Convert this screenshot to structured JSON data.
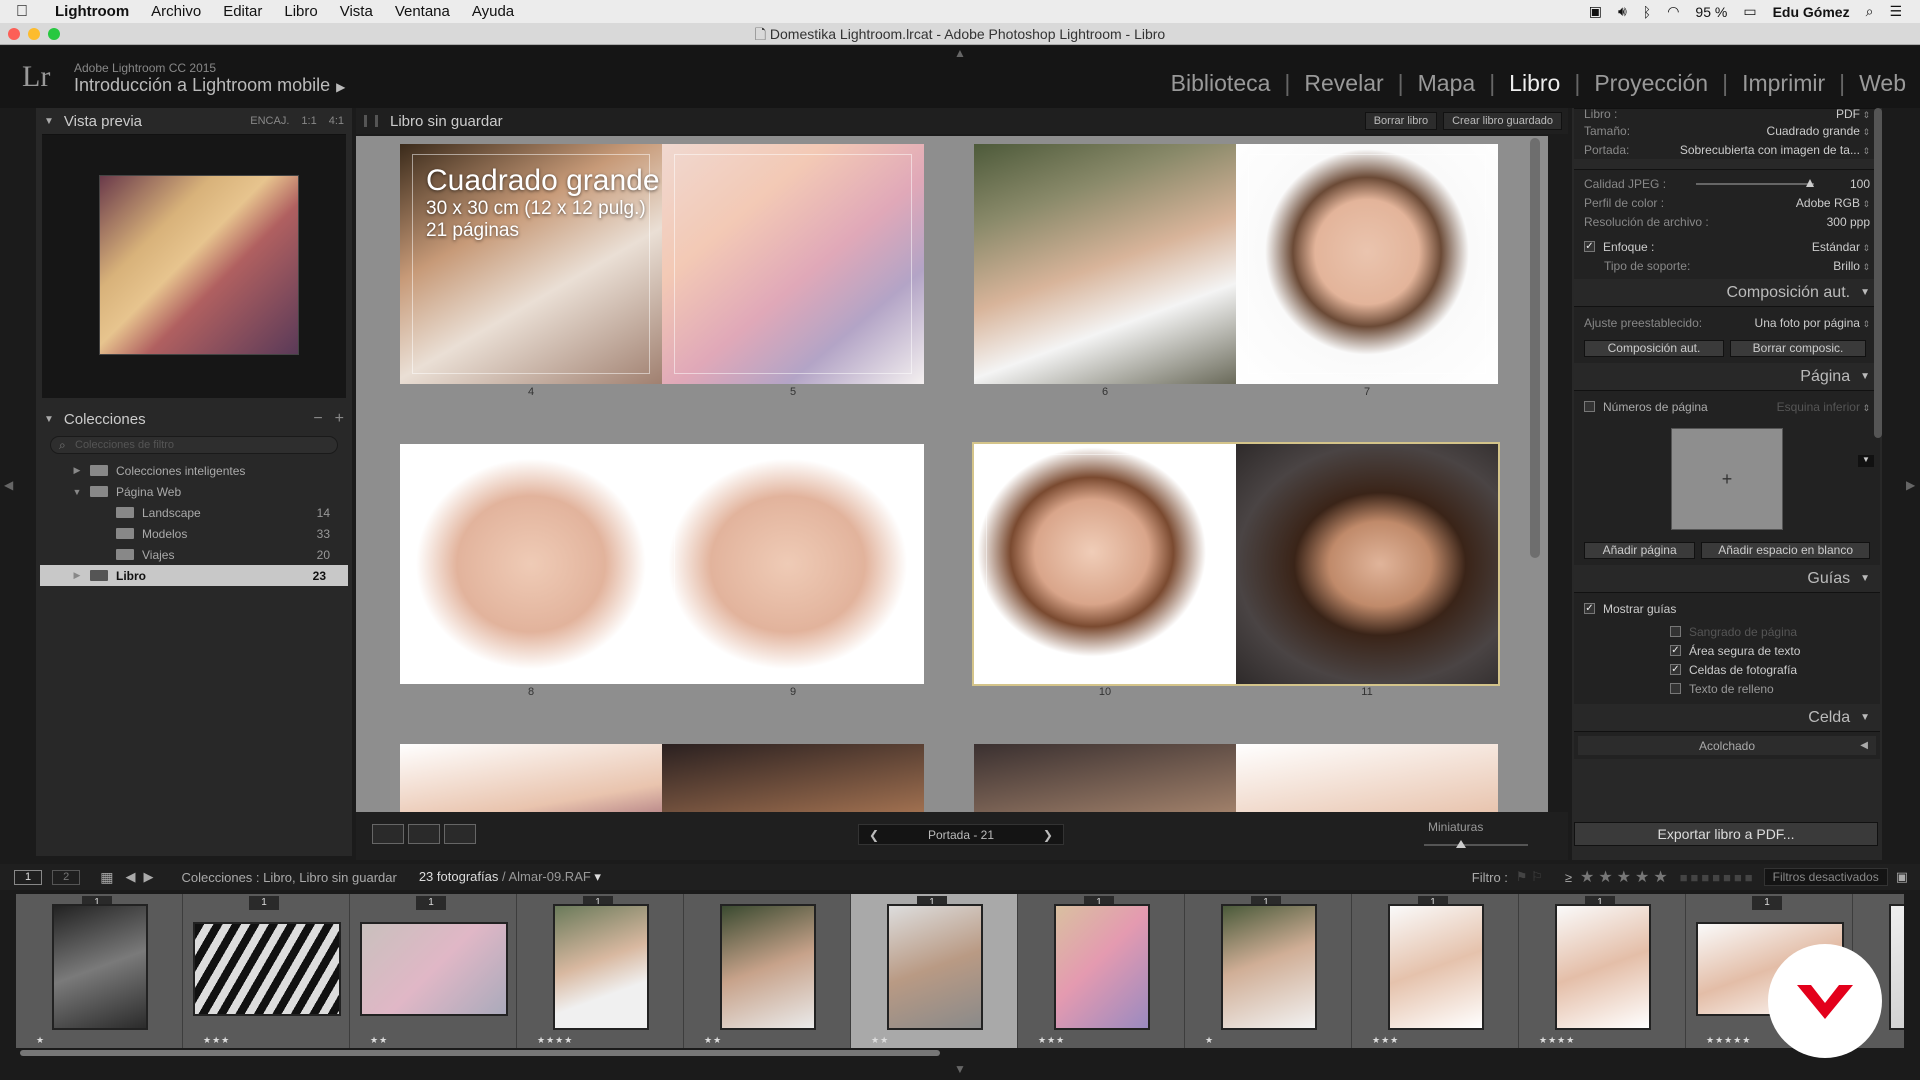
{
  "menubar": {
    "app": "Lightroom",
    "items": [
      "Archivo",
      "Editar",
      "Libro",
      "Vista",
      "Ventana",
      "Ayuda"
    ],
    "battery": "95 %",
    "user": "Edu Gómez"
  },
  "window": {
    "title": "Domestika Lightroom.lrcat - Adobe Photoshop Lightroom - Libro"
  },
  "identity": {
    "logo": "Lr",
    "product": "Adobe Lightroom CC 2015",
    "catalog": "Introducción a Lightroom mobile"
  },
  "modules": [
    "Biblioteca",
    "Revelar",
    "Mapa",
    "Libro",
    "Proyección",
    "Imprimir",
    "Web"
  ],
  "left": {
    "preview": {
      "title": "Vista previa",
      "opts": [
        "ENCAJ.",
        "1:1",
        "4:1"
      ]
    },
    "collections": {
      "title": "Colecciones",
      "search_placeholder": "Colecciones de filtro",
      "items": [
        {
          "label": "Colecciones inteligentes",
          "count": ""
        },
        {
          "label": "Página Web",
          "count": ""
        },
        {
          "label": "Landscape",
          "count": "14"
        },
        {
          "label": "Modelos",
          "count": "33"
        },
        {
          "label": "Viajes",
          "count": "20"
        },
        {
          "label": "Libro",
          "count": "23"
        }
      ]
    }
  },
  "center": {
    "doc_title": "Libro sin guardar",
    "buttons": [
      "Borrar libro",
      "Crear libro guardado"
    ],
    "overlay": {
      "size": "Cuadrado grande",
      "dims": "30 x 30 cm (12 x 12 pulg.)",
      "pages": "21 páginas"
    },
    "page_numbers": [
      "4",
      "5",
      "6",
      "7",
      "8",
      "9",
      "10",
      "11"
    ],
    "pager": "Portada - 21",
    "thumbs_label": "Miniaturas"
  },
  "right": {
    "top": {
      "libro_label": "Libro :",
      "libro_value": "PDF",
      "tamano_label": "Tamaño:",
      "tamano_value": "Cuadrado grande",
      "portada_label": "Portada:",
      "portada_value": "Sobrecubierta con imagen de ta..."
    },
    "jpeg": {
      "calidad_label": "Calidad JPEG :",
      "calidad_value": "100",
      "perfil_label": "Perfil de color :",
      "perfil_value": "Adobe RGB",
      "res_label": "Resolución de archivo :",
      "res_value": "300 ppp",
      "enfoque_label": "Enfoque :",
      "enfoque_value": "Estándar",
      "soporte_label": "Tipo de soporte:",
      "soporte_value": "Brillo"
    },
    "autolayout": {
      "title": "Composición aut.",
      "preset_label": "Ajuste preestablecido:",
      "preset_value": "Una foto por página",
      "btn1": "Composición aut.",
      "btn2": "Borrar composic."
    },
    "page": {
      "title": "Página",
      "numbers_label": "Números de página",
      "numbers_pos": "Esquina inferior",
      "plus": "+",
      "btn1": "Añadir página",
      "btn2": "Añadir espacio en blanco"
    },
    "guides": {
      "title": "Guías",
      "show_label": "Mostrar guías",
      "items": [
        "Sangrado de página",
        "Área segura de texto",
        "Celdas de fotografía",
        "Texto de relleno"
      ]
    },
    "cell": {
      "title": "Celda",
      "padding_label": "Acolchado"
    },
    "export": "Exportar libro a PDF..."
  },
  "filmbar": {
    "btn1": "1",
    "btn2": "2",
    "source": "Colecciones : Libro, Libro sin guardar",
    "count": "23 fotografías",
    "file": "/ Almar-09.RAF",
    "filter_label": "Filtro :",
    "filter_value": "Filtros desactivados"
  },
  "filmstrip": [
    {
      "usage": "1",
      "stars": "★",
      "land": false,
      "g": "linear-gradient(160deg,#222,#7a7a7a 50%,#2b2b2b)"
    },
    {
      "usage": "1",
      "stars": "★★★",
      "land": true,
      "g": "repeating-linear-gradient(120deg,#111 0 8px,#ddd 8px 16px)"
    },
    {
      "usage": "1",
      "stars": "★★",
      "land": true,
      "g": "linear-gradient(135deg,#c9c0bd,#e0b7c6 50%,#aab)"
    },
    {
      "usage": "1",
      "stars": "★★★★",
      "land": false,
      "g": "linear-gradient(160deg,#6a7a5a,#d8b8a0 45%,#f0f0f0 70%)"
    },
    {
      "usage": "",
      "stars": "★★",
      "land": false,
      "g": "linear-gradient(160deg,#3a4a30,#c7a28a 50%,#eaeaea)"
    },
    {
      "usage": "1",
      "stars": "★★",
      "land": false,
      "g": "linear-gradient(160deg,#ddd,#b99a84 50%,#8a8a8a)"
    },
    {
      "usage": "1",
      "stars": "★★★",
      "land": false,
      "g": "linear-gradient(135deg,#d9c0a0,#e49ab0 45%,#9a8ac0)"
    },
    {
      "usage": "1",
      "stars": "★",
      "land": false,
      "g": "linear-gradient(160deg,#4a5a3a,#d0ae96 45%,#f2f2f2)"
    },
    {
      "usage": "1",
      "stars": "★★★",
      "land": false,
      "g": "linear-gradient(160deg,#fafafa,#e5c2ac 50%,#fff)"
    },
    {
      "usage": "1",
      "stars": "★★★★",
      "land": false,
      "g": "linear-gradient(160deg,#fafafa,#e4bea8 50%,#fff)"
    },
    {
      "usage": "1",
      "stars": "★★★★★",
      "land": true,
      "g": "linear-gradient(160deg,#fafafa,#e3bda7 50%,#fff)"
    },
    {
      "usage": "",
      "stars": "",
      "land": false,
      "g": "linear-gradient(160deg,#eee,#ccc)"
    }
  ]
}
